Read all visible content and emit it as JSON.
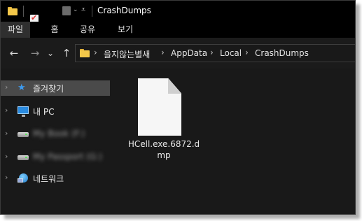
{
  "window": {
    "title": "CrashDumps"
  },
  "ribbon": {
    "tabs": [
      {
        "label": "파일"
      },
      {
        "label": "홈"
      },
      {
        "label": "공유"
      },
      {
        "label": "보기"
      }
    ]
  },
  "nav": {
    "back": "←",
    "forward": "→",
    "recent": "⌄",
    "up": "↑"
  },
  "address": {
    "crumbs": [
      "을지않는별새",
      "AppData",
      "Local",
      "CrashDumps"
    ],
    "separator": "›"
  },
  "sidebar": {
    "items": [
      {
        "label": "즐겨찾기",
        "icon": "star-icon"
      },
      {
        "label": "내 PC",
        "icon": "pc-icon"
      },
      {
        "label": "My Book (F:)",
        "icon": "drive-icon"
      },
      {
        "label": "My Passport (G:)",
        "icon": "drive-icon"
      },
      {
        "label": "네트워크",
        "icon": "network-icon"
      }
    ]
  },
  "files": [
    {
      "name_line1": "HCell.exe.6872.d",
      "name_line2": "mp",
      "icon": "document-icon"
    }
  ],
  "colors": {
    "window_bg": "#1b1b1b",
    "titlebar_bg": "#000000",
    "selected_bg": "#4a4a4a",
    "folder": "#f4c84a",
    "accent": "#3d9bf0"
  }
}
